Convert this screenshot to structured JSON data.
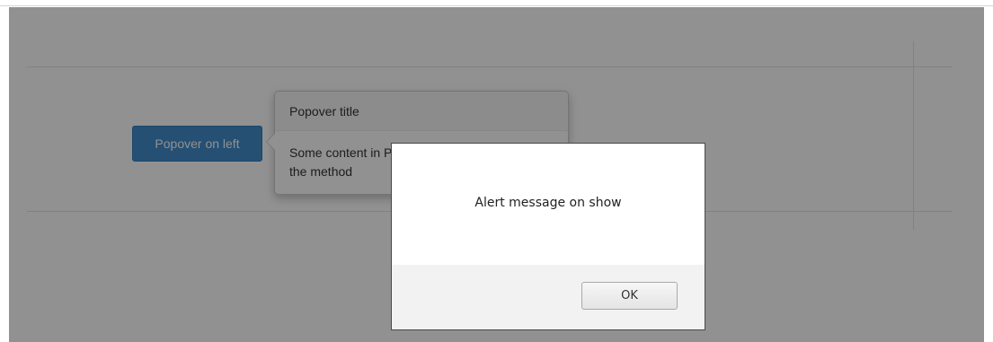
{
  "page": {
    "popover_button_label": "Popover on left",
    "popover": {
      "title": "Popover title",
      "content": "Some content in Popover on left. Also including the method"
    }
  },
  "dialog": {
    "message": "Alert message on show",
    "ok_label": "OK"
  },
  "colors": {
    "button_primary": "#428bca",
    "overlay": "rgba(0,0,0,0.43)",
    "dialog_footer": "#f2f2f2"
  }
}
